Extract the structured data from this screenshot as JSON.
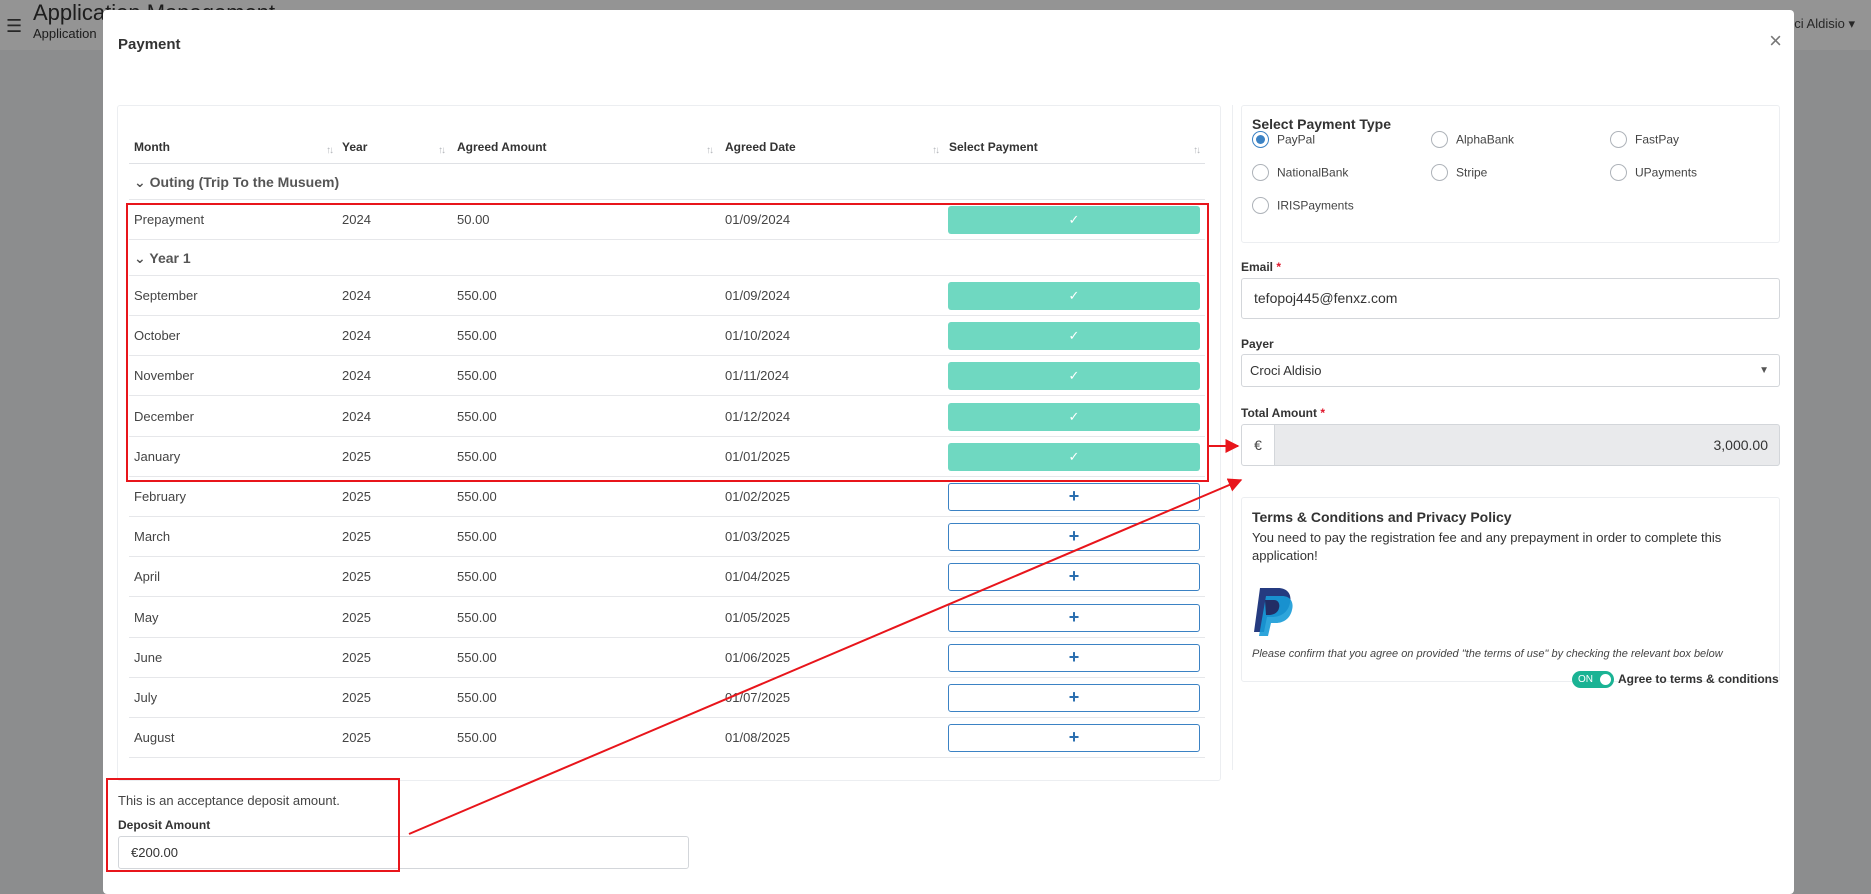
{
  "background": {
    "title": "Application Management",
    "subtitle": "Application",
    "user": "Croci Aldisio"
  },
  "modal": {
    "title": "Payment",
    "close_symbol": "×"
  },
  "table": {
    "columns": [
      "Month",
      "Year",
      "Agreed Amount",
      "Agreed Date",
      "Select Payment"
    ],
    "groups": [
      {
        "label": "Outing (Trip To the Musuem)",
        "rows": [
          {
            "month": "Prepayment",
            "year": "2024",
            "amount": "50.00",
            "date": "01/09/2024",
            "paid": true
          }
        ]
      },
      {
        "label": "Year 1",
        "rows": [
          {
            "month": "September",
            "year": "2024",
            "amount": "550.00",
            "date": "01/09/2024",
            "paid": true
          },
          {
            "month": "October",
            "year": "2024",
            "amount": "550.00",
            "date": "01/10/2024",
            "paid": true
          },
          {
            "month": "November",
            "year": "2024",
            "amount": "550.00",
            "date": "01/11/2024",
            "paid": true
          },
          {
            "month": "December",
            "year": "2024",
            "amount": "550.00",
            "date": "01/12/2024",
            "paid": true
          },
          {
            "month": "January",
            "year": "2025",
            "amount": "550.00",
            "date": "01/01/2025",
            "paid": true
          },
          {
            "month": "February",
            "year": "2025",
            "amount": "550.00",
            "date": "01/02/2025",
            "paid": false
          },
          {
            "month": "March",
            "year": "2025",
            "amount": "550.00",
            "date": "01/03/2025",
            "paid": false
          },
          {
            "month": "April",
            "year": "2025",
            "amount": "550.00",
            "date": "01/04/2025",
            "paid": false
          },
          {
            "month": "May",
            "year": "2025",
            "amount": "550.00",
            "date": "01/05/2025",
            "paid": false
          },
          {
            "month": "June",
            "year": "2025",
            "amount": "550.00",
            "date": "01/06/2025",
            "paid": false
          },
          {
            "month": "July",
            "year": "2025",
            "amount": "550.00",
            "date": "01/07/2025",
            "paid": false
          },
          {
            "month": "August",
            "year": "2025",
            "amount": "550.00",
            "date": "01/08/2025",
            "paid": false
          }
        ]
      }
    ],
    "paid_symbol": "✓",
    "add_symbol": "+"
  },
  "deposit": {
    "text": "This is an acceptance deposit amount.",
    "label": "Deposit Amount",
    "value": "€200.00"
  },
  "payment_type": {
    "title": "Select Payment Type",
    "options": [
      "PayPal",
      "AlphaBank",
      "FastPay",
      "NationalBank",
      "Stripe",
      "UPayments",
      "IRISPayments"
    ],
    "selected": "PayPal"
  },
  "form": {
    "email_label": "Email",
    "email_value": "tefopoj445@fenxz.com",
    "payer_label": "Payer",
    "payer_value": "Croci Aldisio",
    "total_label": "Total Amount",
    "currency_symbol": "€",
    "total_value": "3,000.00",
    "required_mark": "*"
  },
  "terms": {
    "title": "Terms & Conditions and Privacy Policy",
    "body": "You need to pay the registration fee and any prepayment in order to complete this application!",
    "note": "Please confirm that you agree on provided \"the terms of use\" by checking the relevant box below",
    "toggle_state": "ON",
    "toggle_label": "Agree to terms & conditions"
  },
  "colors": {
    "paid": "#6fd8c1",
    "accent": "#3b82c4",
    "annotation": "#e8151b",
    "toggle": "#1ab394"
  },
  "icons": [
    "hamburger-icon",
    "close-icon",
    "sort-icon",
    "chevron-down-icon",
    "check-icon",
    "plus-icon",
    "paypal-logo-icon",
    "caret-down-icon"
  ]
}
